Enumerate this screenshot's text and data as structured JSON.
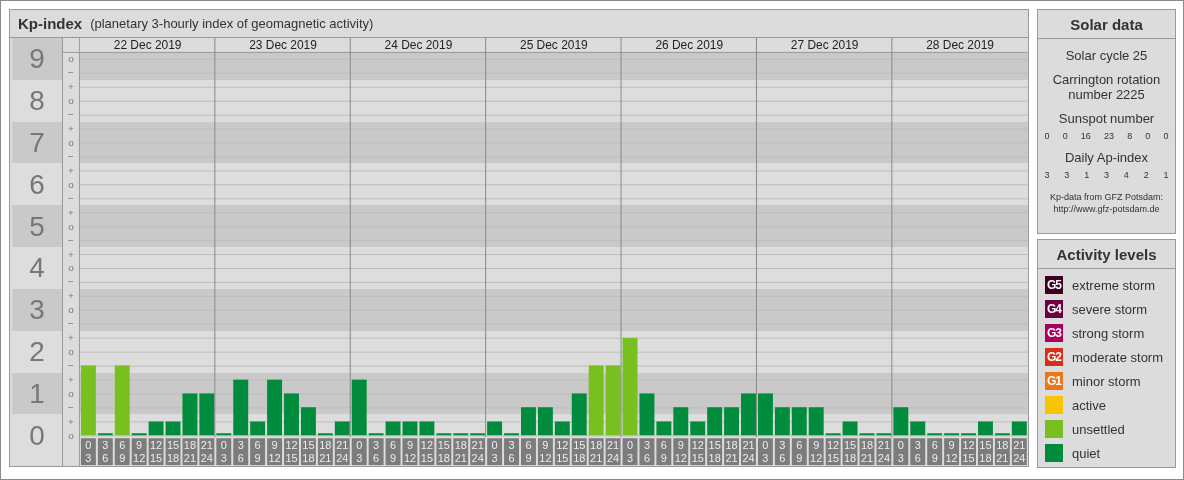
{
  "header": {
    "title": "Kp-index",
    "subtitle": "(planetary 3-hourly index of geomagnetic activity)"
  },
  "minor_ticks": [
    "o",
    "−",
    "+",
    "o",
    "−",
    "+",
    "o",
    "−",
    "+",
    "o",
    "−",
    "+",
    "o",
    "−",
    "+",
    "o",
    "−",
    "+",
    "o",
    "−",
    "+",
    "o",
    "−",
    "+",
    "o",
    "−",
    "+",
    "o"
  ],
  "days": [
    {
      "date": "22 Dec 2019",
      "slots": [
        {
          "start": "0",
          "end": "3"
        },
        {
          "start": "3",
          "end": "6"
        },
        {
          "start": "6",
          "end": "9"
        },
        {
          "start": "9",
          "end": "12"
        },
        {
          "start": "12",
          "end": "15"
        },
        {
          "start": "15",
          "end": "18"
        },
        {
          "start": "18",
          "end": "21"
        },
        {
          "start": "21",
          "end": "24"
        }
      ]
    },
    {
      "date": "23 Dec 2019",
      "slots": [
        {
          "start": "0",
          "end": "3"
        },
        {
          "start": "3",
          "end": "6"
        },
        {
          "start": "6",
          "end": "9"
        },
        {
          "start": "9",
          "end": "12"
        },
        {
          "start": "12",
          "end": "15"
        },
        {
          "start": "15",
          "end": "18"
        },
        {
          "start": "18",
          "end": "21"
        },
        {
          "start": "21",
          "end": "24"
        }
      ]
    },
    {
      "date": "24 Dec 2019",
      "slots": [
        {
          "start": "0",
          "end": "3"
        },
        {
          "start": "3",
          "end": "6"
        },
        {
          "start": "6",
          "end": "9"
        },
        {
          "start": "9",
          "end": "12"
        },
        {
          "start": "12",
          "end": "15"
        },
        {
          "start": "15",
          "end": "18"
        },
        {
          "start": "18",
          "end": "21"
        },
        {
          "start": "21",
          "end": "24"
        }
      ]
    },
    {
      "date": "25 Dec 2019",
      "slots": [
        {
          "start": "0",
          "end": "3"
        },
        {
          "start": "3",
          "end": "6"
        },
        {
          "start": "6",
          "end": "9"
        },
        {
          "start": "9",
          "end": "12"
        },
        {
          "start": "12",
          "end": "15"
        },
        {
          "start": "15",
          "end": "18"
        },
        {
          "start": "18",
          "end": "21"
        },
        {
          "start": "21",
          "end": "24"
        }
      ]
    },
    {
      "date": "26 Dec 2019",
      "slots": [
        {
          "start": "0",
          "end": "3"
        },
        {
          "start": "3",
          "end": "6"
        },
        {
          "start": "6",
          "end": "9"
        },
        {
          "start": "9",
          "end": "12"
        },
        {
          "start": "12",
          "end": "15"
        },
        {
          "start": "15",
          "end": "18"
        },
        {
          "start": "18",
          "end": "21"
        },
        {
          "start": "21",
          "end": "24"
        }
      ]
    },
    {
      "date": "27 Dec 2019",
      "slots": [
        {
          "start": "0",
          "end": "3"
        },
        {
          "start": "3",
          "end": "6"
        },
        {
          "start": "6",
          "end": "9"
        },
        {
          "start": "9",
          "end": "12"
        },
        {
          "start": "12",
          "end": "15"
        },
        {
          "start": "15",
          "end": "18"
        },
        {
          "start": "18",
          "end": "21"
        },
        {
          "start": "21",
          "end": "24"
        }
      ]
    },
    {
      "date": "28 Dec 2019",
      "slots": [
        {
          "start": "0",
          "end": "3"
        },
        {
          "start": "3",
          "end": "6"
        },
        {
          "start": "6",
          "end": "9"
        },
        {
          "start": "9",
          "end": "12"
        },
        {
          "start": "12",
          "end": "15"
        },
        {
          "start": "15",
          "end": "18"
        },
        {
          "start": "18",
          "end": "21"
        },
        {
          "start": "21",
          "end": "24"
        }
      ]
    }
  ],
  "chart_data": {
    "type": "bar",
    "grid": true,
    "ylim": [
      0,
      9
    ],
    "yticks": [
      0,
      1,
      2,
      3,
      4,
      5,
      6,
      7,
      8,
      9
    ],
    "series": [
      {
        "color": "#008c3c",
        "values": [
          null,
          0,
          null,
          0,
          0.33,
          0.33,
          1,
          1,
          0,
          1.33,
          0.33,
          1.33,
          1,
          0.67,
          0,
          0.33,
          1.33,
          0,
          0.33,
          0.33,
          0.33,
          0,
          0,
          0,
          0.33,
          0,
          0.67,
          0.67,
          0.33,
          1,
          null,
          null,
          null,
          1,
          0.33,
          0.67,
          0.33,
          0.67,
          0.67,
          1,
          1,
          0.67,
          0.67,
          0.67,
          0,
          0.33,
          0,
          0,
          0.67,
          0.33,
          0,
          0,
          0,
          0.33,
          0,
          0.33
        ]
      },
      {
        "color": "#78c020",
        "values": [
          1.67,
          null,
          1.67,
          null,
          null,
          null,
          null,
          null,
          null,
          null,
          null,
          null,
          null,
          null,
          null,
          null,
          null,
          null,
          null,
          null,
          null,
          null,
          null,
          null,
          null,
          null,
          null,
          null,
          null,
          null,
          1.67,
          1.67,
          2.33,
          null,
          null,
          null,
          null,
          null,
          null,
          null,
          null,
          null,
          null,
          null,
          null,
          null,
          null,
          null,
          null,
          null,
          null,
          null,
          null,
          null,
          null,
          null
        ]
      }
    ]
  },
  "solar_data": {
    "title": "Solar data",
    "solar_cycle": "Solar cycle 25",
    "carrington": "Carrington rotation number 2225",
    "sunspot_label": "Sunspot number",
    "sunspot_values": [
      "0",
      "0",
      "16",
      "23",
      "8",
      "0",
      "0"
    ],
    "ap_label": "Daily Ap-index",
    "ap_values": [
      "3",
      "3",
      "1",
      "3",
      "4",
      "2",
      "1"
    ],
    "source_lines": [
      "Kp-data from GFZ Potsdam:",
      "http://www.gfz-potsdam.de"
    ]
  },
  "activity_levels": {
    "title": "Activity levels",
    "items": [
      {
        "badge": "G5",
        "label": "extreme storm",
        "color": "#3c0020"
      },
      {
        "badge": "G4",
        "label": "severe storm",
        "color": "#6c0040"
      },
      {
        "badge": "G3",
        "label": "strong storm",
        "color": "#a8005c"
      },
      {
        "badge": "G2",
        "label": "moderate storm",
        "color": "#d83018"
      },
      {
        "badge": "G1",
        "label": "minor storm",
        "color": "#e87818"
      },
      {
        "label": "active",
        "color": "#f8c400"
      },
      {
        "label": "unsettled",
        "color": "#78c020"
      },
      {
        "label": "quiet",
        "color": "#008c3c"
      }
    ]
  }
}
